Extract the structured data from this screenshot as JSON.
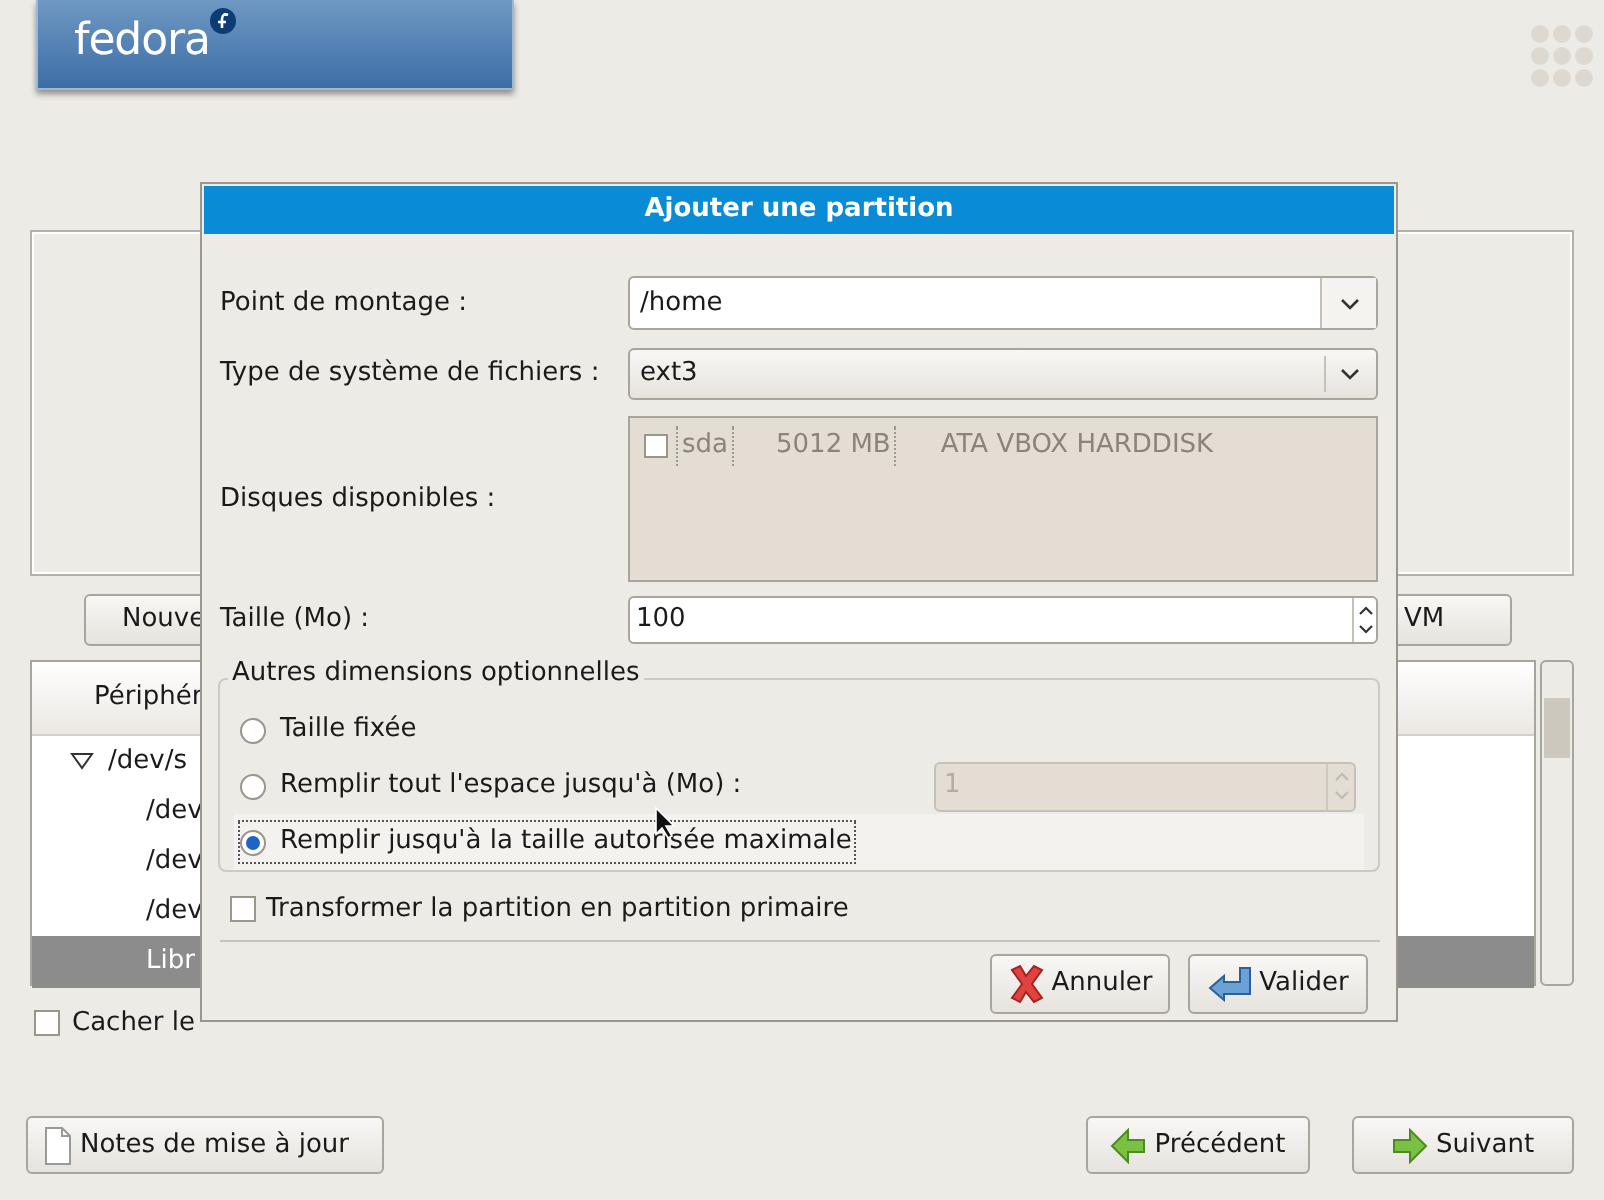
{
  "banner": {
    "logo": "fedora"
  },
  "background": {
    "buttons": [
      "Nouve",
      "VM"
    ],
    "tree": {
      "header": "Périphér",
      "rows": [
        {
          "label": "/dev/s",
          "expanded": true,
          "selected": false,
          "children": [
            {
              "label": "/dev",
              "selected": false
            },
            {
              "label": "/dev",
              "selected": false
            },
            {
              "label": "/dev",
              "selected": false
            },
            {
              "label": "Libr",
              "selected": true
            }
          ]
        }
      ]
    },
    "hide_checkbox": {
      "label": "Cacher le",
      "checked": false
    }
  },
  "dialog": {
    "title": "Ajouter une partition",
    "fields": [
      {
        "kind": "combo",
        "label": "Point de montage :",
        "value": "/home"
      },
      {
        "kind": "select",
        "label": "Type de système de fichiers :",
        "value": "ext3"
      },
      {
        "kind": "disks",
        "label": "Disques disponibles :",
        "disabled": true,
        "disks": [
          {
            "checked": false,
            "name": "sda",
            "size": "5012 MB",
            "model": "ATA VBOX HARDDISK"
          }
        ]
      },
      {
        "kind": "spin",
        "label": "Taille (Mo) :",
        "value": "100"
      }
    ],
    "options": {
      "legend": "Autres dimensions optionnelles",
      "choices": [
        {
          "label": "Taille fixée",
          "selected": false
        },
        {
          "label": "Remplir tout l'espace jusqu'à (Mo) :",
          "selected": false,
          "spin": {
            "value": "1",
            "disabled": true
          }
        },
        {
          "label": "Remplir jusqu'à la taille autorisée maximale",
          "selected": true
        }
      ]
    },
    "primary": {
      "label": "Transformer la partition en partition primaire",
      "checked": false
    },
    "buttons": [
      {
        "label": "Annuler"
      },
      {
        "label": "Valider"
      }
    ]
  },
  "nav_buttons": [
    {
      "label": "Notes de mise à jour"
    },
    {
      "label": "Précédent"
    },
    {
      "label": "Suivant"
    }
  ]
}
